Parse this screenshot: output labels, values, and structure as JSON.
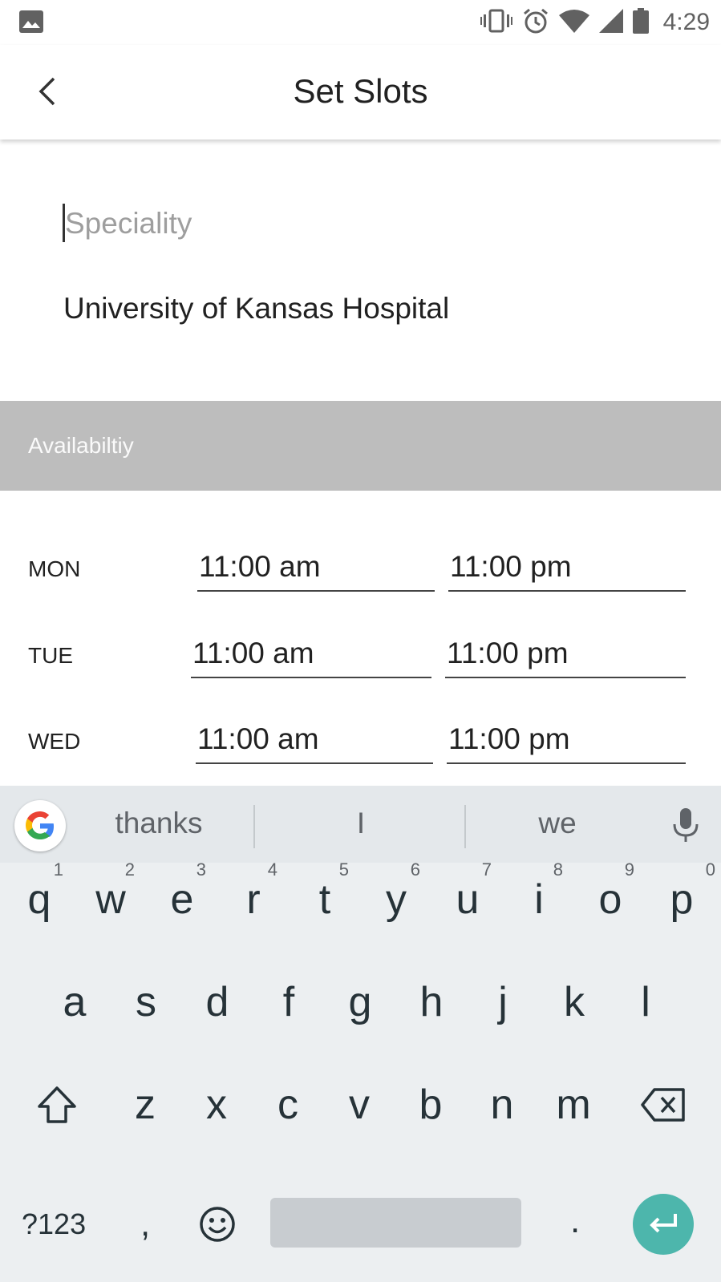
{
  "status_bar": {
    "time": "4:29",
    "icons": [
      "gallery-icon",
      "vibrate-icon",
      "alarm-icon",
      "wifi-icon",
      "signal-icon",
      "battery-icon"
    ]
  },
  "app_bar": {
    "title": "Set Slots",
    "back_icon": "back-arrow-icon"
  },
  "form": {
    "speciality_placeholder": "Speciality",
    "speciality_value": "",
    "hospital": "University of Kansas Hospital"
  },
  "availability": {
    "header": "Availabiltiy",
    "days": [
      {
        "day": "MON",
        "start": "11:00 am",
        "end": "11:00 pm"
      },
      {
        "day": "TUE",
        "start": "11:00 am",
        "end": "11:00 pm"
      },
      {
        "day": "WED",
        "start": "11:00 am",
        "end": "11:00 pm"
      }
    ]
  },
  "keyboard": {
    "suggestions": [
      "thanks",
      "I",
      "we"
    ],
    "row1": [
      {
        "key": "q",
        "hint": "1"
      },
      {
        "key": "w",
        "hint": "2"
      },
      {
        "key": "e",
        "hint": "3"
      },
      {
        "key": "r",
        "hint": "4"
      },
      {
        "key": "t",
        "hint": "5"
      },
      {
        "key": "y",
        "hint": "6"
      },
      {
        "key": "u",
        "hint": "7"
      },
      {
        "key": "i",
        "hint": "8"
      },
      {
        "key": "o",
        "hint": "9"
      },
      {
        "key": "p",
        "hint": "0"
      }
    ],
    "row2": [
      "a",
      "s",
      "d",
      "f",
      "g",
      "h",
      "j",
      "k",
      "l"
    ],
    "row3": [
      "z",
      "x",
      "c",
      "v",
      "b",
      "n",
      "m"
    ],
    "symbols_label": "?123",
    "comma": ",",
    "period": ".",
    "accent_color": "#4db6ac"
  }
}
